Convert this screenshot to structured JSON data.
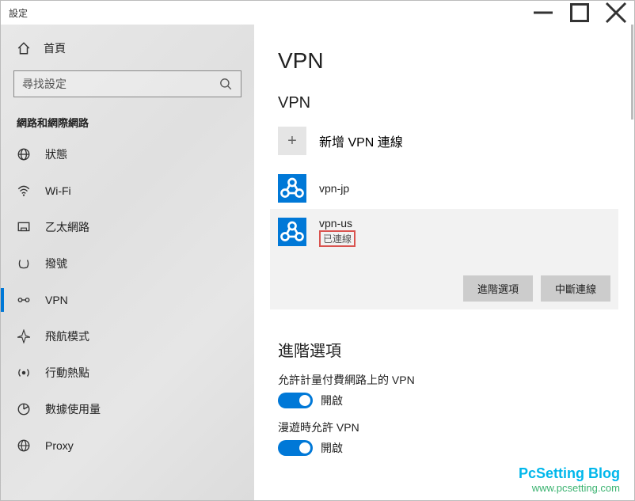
{
  "window": {
    "title": "設定"
  },
  "sidebar": {
    "home": "首頁",
    "searchPlaceholder": "尋找設定",
    "sectionTitle": "網路和網際網路",
    "items": [
      {
        "label": "狀態",
        "icon": "status"
      },
      {
        "label": "Wi-Fi",
        "icon": "wifi"
      },
      {
        "label": "乙太網路",
        "icon": "ethernet"
      },
      {
        "label": "撥號",
        "icon": "dialup"
      },
      {
        "label": "VPN",
        "icon": "vpn",
        "active": true
      },
      {
        "label": "飛航模式",
        "icon": "airplane"
      },
      {
        "label": "行動熱點",
        "icon": "hotspot"
      },
      {
        "label": "數據使用量",
        "icon": "datausage"
      },
      {
        "label": "Proxy",
        "icon": "proxy"
      }
    ]
  },
  "main": {
    "title": "VPN",
    "vpnSection": "VPN",
    "addVpn": "新增 VPN 連線",
    "connections": [
      {
        "name": "vpn-jp"
      },
      {
        "name": "vpn-us",
        "status": "已連線",
        "selected": true
      }
    ],
    "btnAdvanced": "進階選項",
    "btnDisconnect": "中斷連線",
    "advancedTitle": "進階選項",
    "meteredLabel": "允許計量付費網路上的 VPN",
    "roamingLabel": "漫遊時允許 VPN",
    "onLabel": "開啟"
  },
  "watermark": {
    "line1": "PcSetting Blog",
    "line2": "www.pcsetting.com"
  }
}
